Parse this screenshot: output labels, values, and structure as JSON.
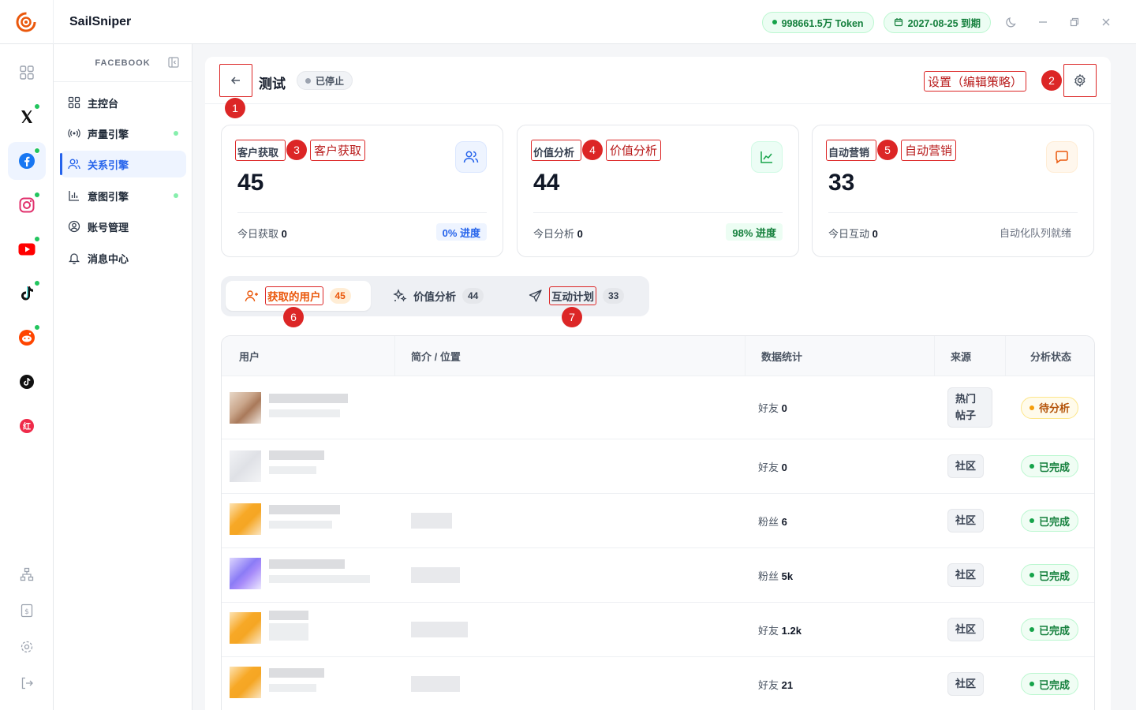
{
  "app": {
    "name": "SailSniper"
  },
  "header": {
    "token": "998661.5万 Token",
    "expiry": "2027-08-25 到期"
  },
  "colors": {
    "accent": "#2563eb",
    "orange": "#ea580c",
    "green": "#15803d",
    "annotation": "#dc2626"
  },
  "rail": {
    "items": [
      {
        "icon": "grid-icon",
        "online": false
      },
      {
        "icon": "x-icon",
        "online": true
      },
      {
        "icon": "facebook-icon",
        "online": true,
        "active": true
      },
      {
        "icon": "instagram-icon",
        "online": true
      },
      {
        "icon": "youtube-icon",
        "online": true
      },
      {
        "icon": "tiktok-icon",
        "online": true
      },
      {
        "icon": "reddit-icon",
        "online": true
      },
      {
        "icon": "tiktok-alt-icon",
        "online": false
      },
      {
        "icon": "xiaohongshu-icon",
        "online": false
      }
    ],
    "xhs_label": "红"
  },
  "sidebar": {
    "section": "FACEBOOK",
    "items": [
      {
        "label": "主控台"
      },
      {
        "label": "声量引擎"
      },
      {
        "label": "关系引擎"
      },
      {
        "label": "意图引擎"
      },
      {
        "label": "账号管理"
      },
      {
        "label": "消息中心"
      }
    ]
  },
  "panel": {
    "title": "测试",
    "status": "已停止"
  },
  "annotations": {
    "n1": "1",
    "n2": "2",
    "n3": "3",
    "n4": "4",
    "n5": "5",
    "n6": "6",
    "n7": "7",
    "settings": "设置（编辑策略）",
    "acquire": "客户获取",
    "value": "价值分析",
    "marketing": "自动营销"
  },
  "cards": [
    {
      "label": "客户获取",
      "value": "45",
      "foot_label": "今日获取",
      "foot_value": "0",
      "badge": "0% 进度"
    },
    {
      "label": "价值分析",
      "value": "44",
      "foot_label": "今日分析",
      "foot_value": "0",
      "badge": "98% 进度"
    },
    {
      "label": "自动营销",
      "value": "33",
      "foot_label": "今日互动",
      "foot_value": "0",
      "badge": "自动化队列就绪"
    }
  ],
  "tabs": [
    {
      "label": "获取的用户",
      "count": "45"
    },
    {
      "label": "价值分析",
      "count": "44"
    },
    {
      "label": "互动计划",
      "count": "33"
    }
  ],
  "table": {
    "headers": {
      "user": "用户",
      "bio": "简介 / 位置",
      "stats": "数据统计",
      "source": "来源",
      "state": "分析状态"
    },
    "rows": [
      {
        "stat_label": "好友",
        "stat_value": "0",
        "source": "热门帖子",
        "state": "待分析",
        "state_kind": "pending"
      },
      {
        "stat_label": "好友",
        "stat_value": "0",
        "source": "社区",
        "state": "已完成",
        "state_kind": "done"
      },
      {
        "stat_label": "粉丝",
        "stat_value": "6",
        "source": "社区",
        "state": "已完成",
        "state_kind": "done"
      },
      {
        "stat_label": "粉丝",
        "stat_value": "5k",
        "source": "社区",
        "state": "已完成",
        "state_kind": "done"
      },
      {
        "stat_label": "好友",
        "stat_value": "1.2k",
        "source": "社区",
        "state": "已完成",
        "state_kind": "done"
      },
      {
        "stat_label": "好友",
        "stat_value": "21",
        "source": "社区",
        "state": "已完成",
        "state_kind": "done"
      }
    ]
  }
}
